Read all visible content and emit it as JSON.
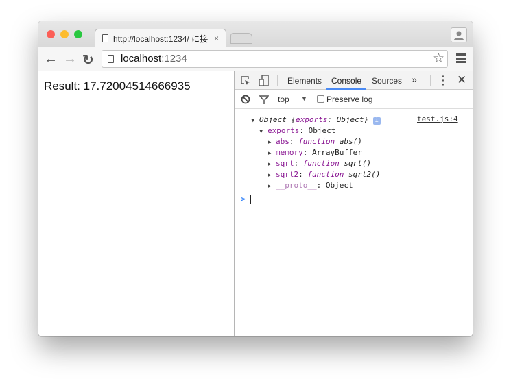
{
  "tab": {
    "title": "http://localhost:1234/ に接",
    "close": "×"
  },
  "address": {
    "host": "localhost",
    "port": ":1234"
  },
  "page": {
    "result": "Result: 17.72004514666935"
  },
  "devtools": {
    "tabs": [
      "Elements",
      "Console",
      "Sources"
    ],
    "more": "»",
    "active_tab": "Console",
    "context": "top",
    "preserve_log": "Preserve log",
    "source_link": "test.js:4",
    "root": {
      "label": "Object",
      "preview_key": "exports",
      "preview_val": "Object"
    },
    "exports": {
      "key": "exports",
      "value": "Object"
    },
    "props": [
      {
        "key": "abs",
        "kw": "function",
        "val": "abs()"
      },
      {
        "key": "memory",
        "val": "ArrayBuffer"
      },
      {
        "key": "sqrt",
        "kw": "function",
        "val": "sqrt()"
      },
      {
        "key": "sqrt2",
        "kw": "function",
        "val": "sqrt2()"
      },
      {
        "key": "__proto__",
        "val": "Object"
      }
    ],
    "prompt": ">"
  }
}
